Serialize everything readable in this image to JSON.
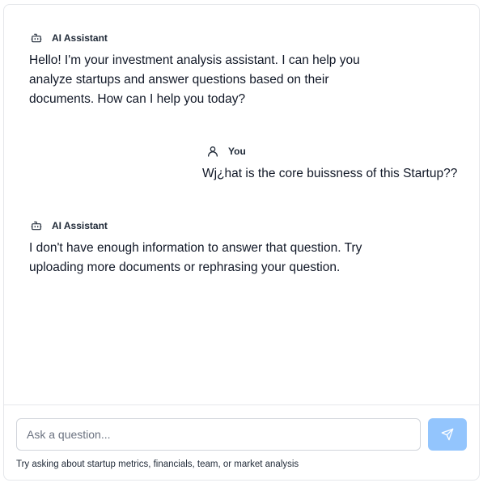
{
  "chat": {
    "messages": [
      {
        "author": "AI Assistant",
        "icon": "bot-icon",
        "text": "Hello! I'm your investment analysis assistant. I can help you analyze startups and answer questions based on their documents. How can I help you today?"
      },
      {
        "author": "You",
        "icon": "user-icon",
        "text": "Wj¿hat is the core buissness of this Startup??"
      },
      {
        "author": "AI Assistant",
        "icon": "bot-icon",
        "text": "I don't have enough information to answer that question. Try uploading more documents or rephrasing your question."
      }
    ]
  },
  "composer": {
    "value": "",
    "placeholder": "Ask a question...",
    "send_icon": "send-icon",
    "hint": "Try asking about startup metrics, financials, team, or market analysis"
  },
  "colors": {
    "send_button": "#93c5fd",
    "border": "#e5e7eb"
  }
}
